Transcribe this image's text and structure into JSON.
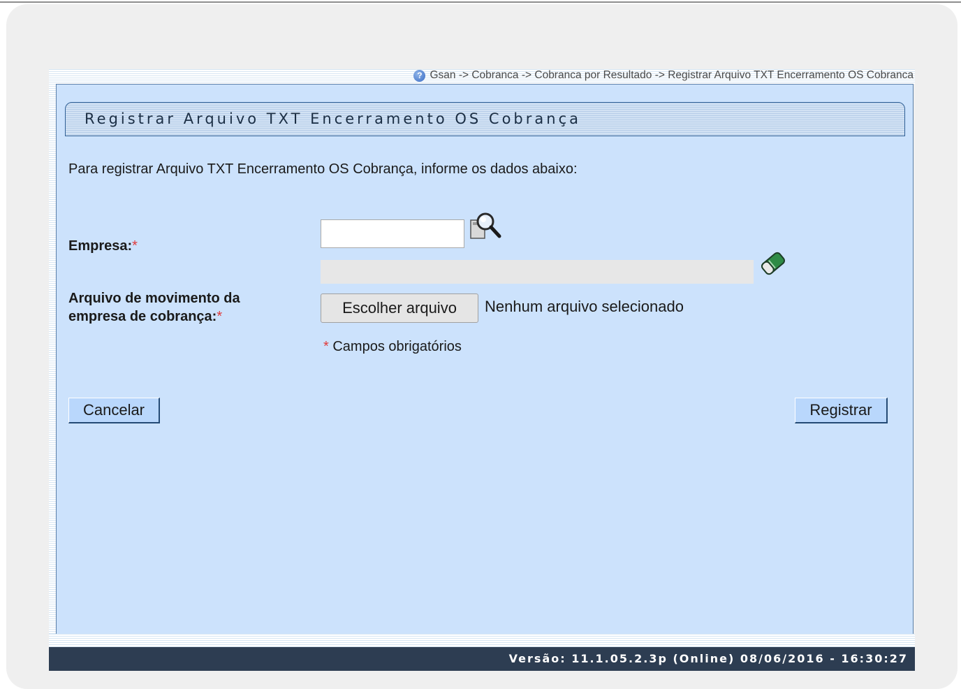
{
  "breadcrumb": {
    "help_icon": "question-circle-icon",
    "text": "Gsan -> Cobranca -> Cobranca por Resultado -> Registrar Arquivo TXT Encerramento OS Cobranca"
  },
  "form": {
    "title": "Registrar Arquivo TXT Encerramento OS Cobrança",
    "intro": "Para registrar Arquivo TXT Encerramento OS Cobrança, informe os dados abaixo:",
    "empresa_label": "Empresa:",
    "empresa_value": "",
    "empresa_descricao": "",
    "search_icon": "magnifier-icon",
    "clear_icon": "eraser-icon",
    "arquivo_label": "Arquivo de movimento da empresa de cobrança:",
    "required_mark": "*",
    "file_button": "Escolher arquivo",
    "file_status": "Nenhum arquivo selecionado",
    "required_note": "Campos obrigatórios"
  },
  "actions": {
    "cancel": "Cancelar",
    "register": "Registrar"
  },
  "footer": {
    "version": "Versão: 11.1.05.2.3p (Online) 08/06/2016 - 16:30:27"
  },
  "colors": {
    "panel_bg": "#cce2fc",
    "footer_bg": "#2d3d52",
    "button_bg": "#b9d7fc",
    "required": "#e13a3a"
  }
}
